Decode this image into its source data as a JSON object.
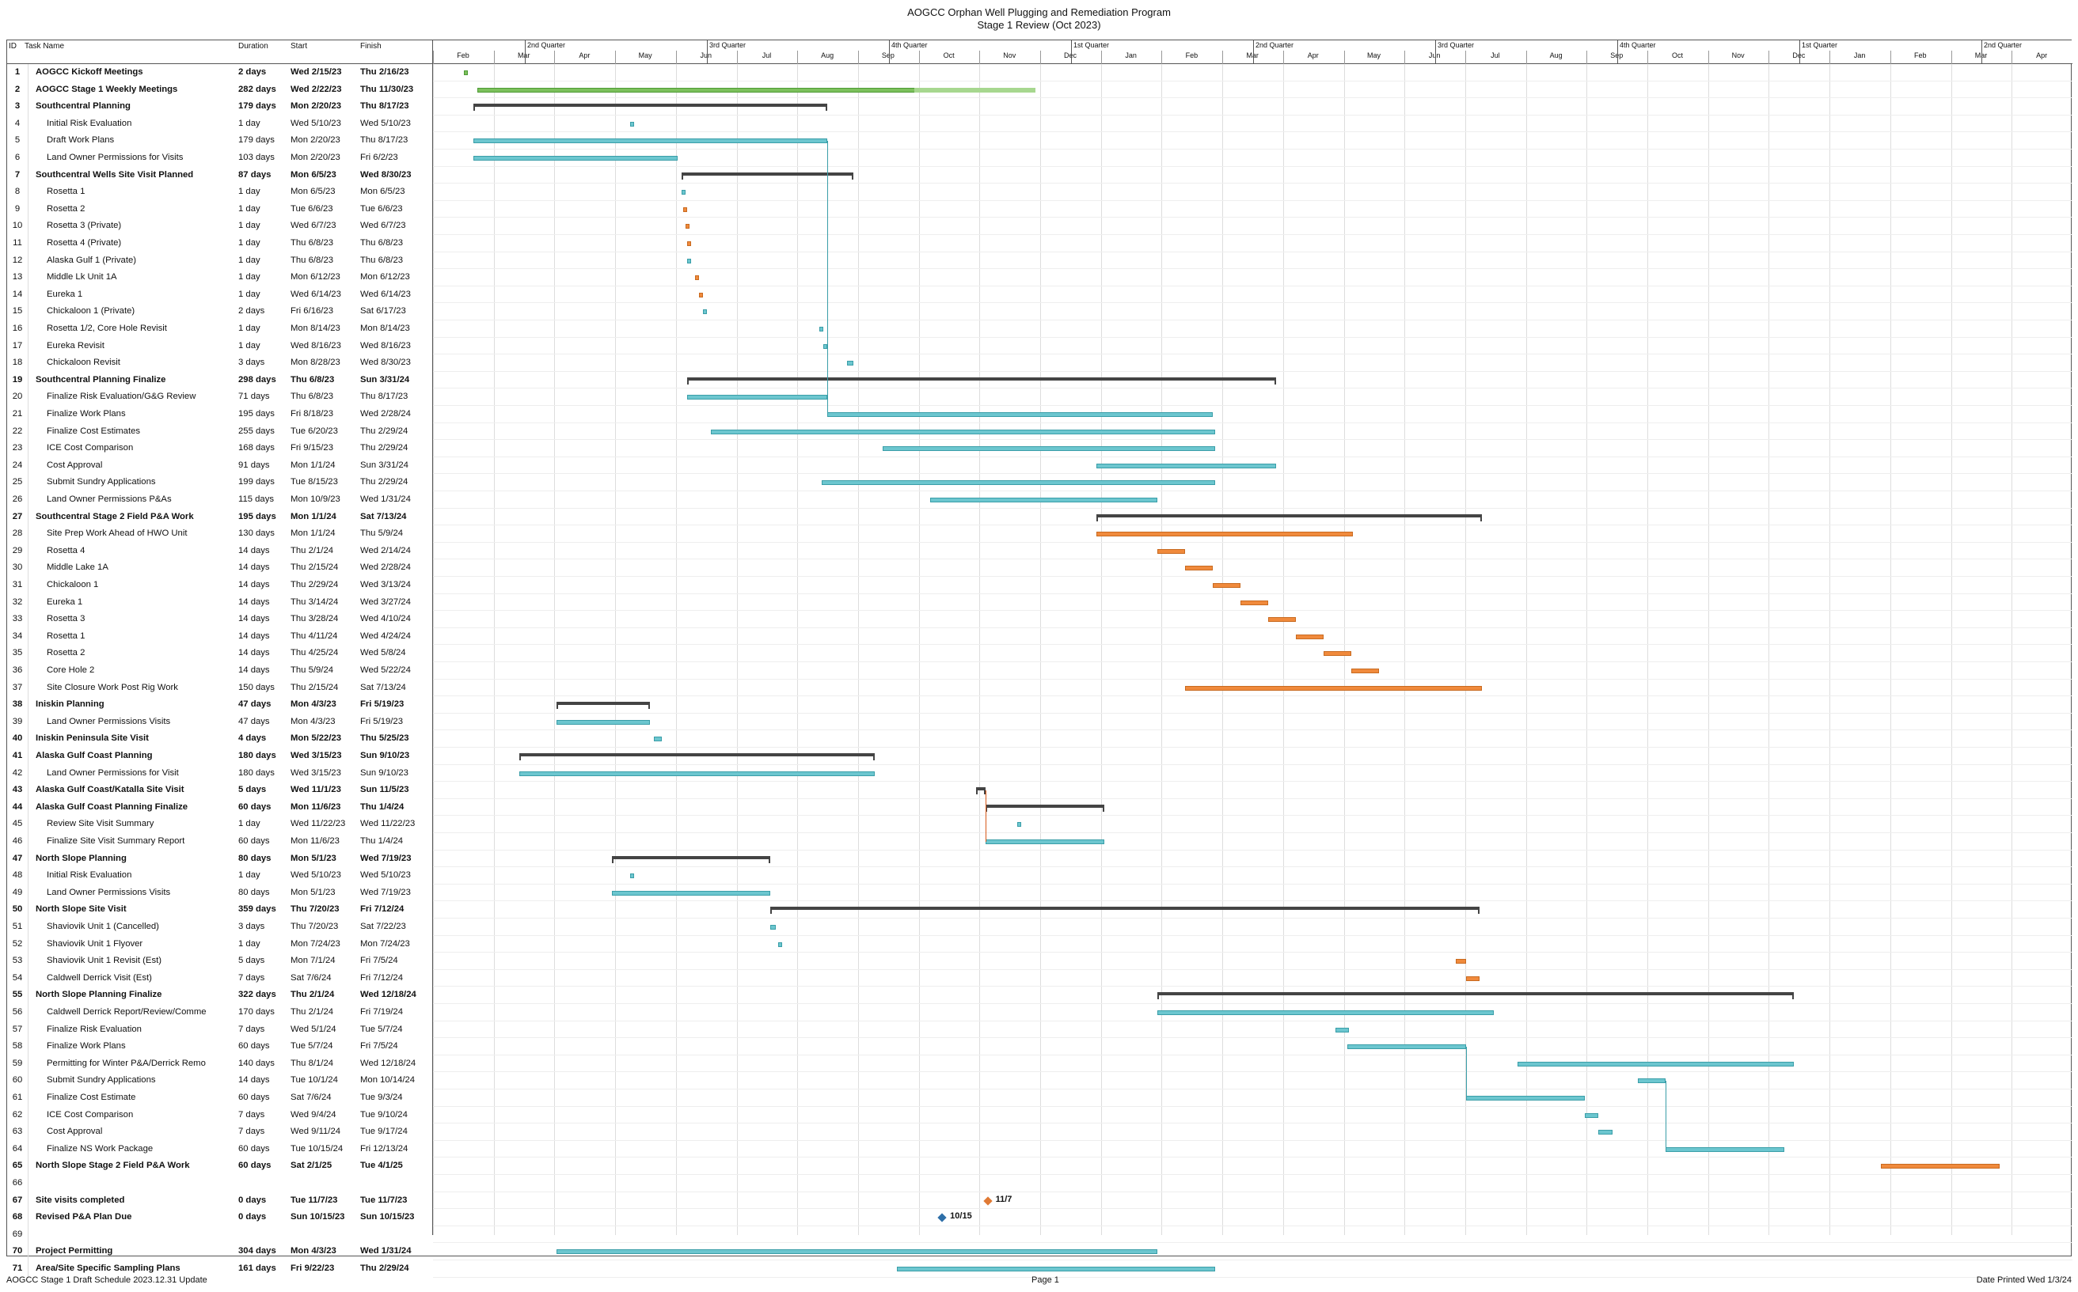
{
  "title": {
    "line1": "AOGCC Orphan Well Plugging and Remediation Program",
    "line2": "Stage 1 Review (Oct 2023)"
  },
  "columns": {
    "id": "ID",
    "name": "Task Name",
    "duration": "Duration",
    "start": "Start",
    "finish": "Finish"
  },
  "timeline": {
    "quarters": [
      "2nd Quarter",
      "3rd Quarter",
      "4th Quarter",
      "1st Quarter",
      "2nd Quarter",
      "3rd Quarter",
      "4th Quarter",
      "1st Quarter",
      "2nd Quarter"
    ],
    "months": [
      "Feb",
      "Mar",
      "Apr",
      "May",
      "Jun",
      "Jul",
      "Aug",
      "Sep",
      "Oct",
      "Nov",
      "Dec",
      "Jan",
      "Feb",
      "Mar",
      "Apr",
      "May",
      "Jun",
      "Jul",
      "Aug",
      "Sep",
      "Oct",
      "Nov",
      "Dec",
      "Jan",
      "Feb",
      "Mar",
      "Apr"
    ]
  },
  "rows": [
    {
      "id": "1",
      "name": "AOGCC Kickoff Meetings",
      "duration": "2 days",
      "start": "Wed 2/15/23",
      "finish": "Thu 2/16/23",
      "level": 0,
      "summary": true
    },
    {
      "id": "2",
      "name": "AOGCC Stage 1 Weekly Meetings",
      "duration": "282 days",
      "start": "Wed 2/22/23",
      "finish": "Thu 11/30/23",
      "level": 0,
      "summary": true
    },
    {
      "id": "3",
      "name": "Southcentral Planning",
      "duration": "179 days",
      "start": "Mon 2/20/23",
      "finish": "Thu 8/17/23",
      "level": 0,
      "summary": true
    },
    {
      "id": "4",
      "name": "Initial Risk Evaluation",
      "duration": "1 day",
      "start": "Wed 5/10/23",
      "finish": "Wed 5/10/23",
      "level": 1
    },
    {
      "id": "5",
      "name": "Draft Work Plans",
      "duration": "179 days",
      "start": "Mon 2/20/23",
      "finish": "Thu 8/17/23",
      "level": 1
    },
    {
      "id": "6",
      "name": "Land Owner Permissions for Visits",
      "duration": "103 days",
      "start": "Mon 2/20/23",
      "finish": "Fri 6/2/23",
      "level": 1
    },
    {
      "id": "7",
      "name": "Southcentral Wells Site Visit Planned",
      "duration": "87 days",
      "start": "Mon 6/5/23",
      "finish": "Wed 8/30/23",
      "level": 0,
      "summary": true
    },
    {
      "id": "8",
      "name": "Rosetta 1",
      "duration": "1 day",
      "start": "Mon 6/5/23",
      "finish": "Mon 6/5/23",
      "level": 1
    },
    {
      "id": "9",
      "name": "Rosetta 2",
      "duration": "1 day",
      "start": "Tue 6/6/23",
      "finish": "Tue 6/6/23",
      "level": 1
    },
    {
      "id": "10",
      "name": "Rosetta 3 (Private)",
      "duration": "1 day",
      "start": "Wed 6/7/23",
      "finish": "Wed 6/7/23",
      "level": 1
    },
    {
      "id": "11",
      "name": "Rosetta 4 (Private)",
      "duration": "1 day",
      "start": "Thu 6/8/23",
      "finish": "Thu 6/8/23",
      "level": 1
    },
    {
      "id": "12",
      "name": "Alaska Gulf 1 (Private)",
      "duration": "1 day",
      "start": "Thu 6/8/23",
      "finish": "Thu 6/8/23",
      "level": 1
    },
    {
      "id": "13",
      "name": "Middle Lk Unit 1A",
      "duration": "1 day",
      "start": "Mon 6/12/23",
      "finish": "Mon 6/12/23",
      "level": 1
    },
    {
      "id": "14",
      "name": "Eureka 1",
      "duration": "1 day",
      "start": "Wed 6/14/23",
      "finish": "Wed 6/14/23",
      "level": 1
    },
    {
      "id": "15",
      "name": "Chickaloon 1 (Private)",
      "duration": "2 days",
      "start": "Fri 6/16/23",
      "finish": "Sat 6/17/23",
      "level": 1
    },
    {
      "id": "16",
      "name": "Rosetta 1/2, Core Hole Revisit",
      "duration": "1 day",
      "start": "Mon 8/14/23",
      "finish": "Mon 8/14/23",
      "level": 1
    },
    {
      "id": "17",
      "name": "Eureka Revisit",
      "duration": "1 day",
      "start": "Wed 8/16/23",
      "finish": "Wed 8/16/23",
      "level": 1
    },
    {
      "id": "18",
      "name": "Chickaloon Revisit",
      "duration": "3 days",
      "start": "Mon 8/28/23",
      "finish": "Wed 8/30/23",
      "level": 1
    },
    {
      "id": "19",
      "name": "Southcentral Planning Finalize",
      "duration": "298 days",
      "start": "Thu 6/8/23",
      "finish": "Sun 3/31/24",
      "level": 0,
      "summary": true
    },
    {
      "id": "20",
      "name": "Finalize Risk Evaluation/G&G Review",
      "duration": "71 days",
      "start": "Thu 6/8/23",
      "finish": "Thu 8/17/23",
      "level": 1
    },
    {
      "id": "21",
      "name": "Finalize Work Plans",
      "duration": "195 days",
      "start": "Fri 8/18/23",
      "finish": "Wed 2/28/24",
      "level": 1
    },
    {
      "id": "22",
      "name": "Finalize Cost Estimates",
      "duration": "255 days",
      "start": "Tue 6/20/23",
      "finish": "Thu 2/29/24",
      "level": 1
    },
    {
      "id": "23",
      "name": "ICE Cost Comparison",
      "duration": "168 days",
      "start": "Fri 9/15/23",
      "finish": "Thu 2/29/24",
      "level": 1
    },
    {
      "id": "24",
      "name": "Cost Approval",
      "duration": "91 days",
      "start": "Mon 1/1/24",
      "finish": "Sun 3/31/24",
      "level": 1
    },
    {
      "id": "25",
      "name": "Submit Sundry Applications",
      "duration": "199 days",
      "start": "Tue 8/15/23",
      "finish": "Thu 2/29/24",
      "level": 1
    },
    {
      "id": "26",
      "name": "Land Owner Permissions P&As",
      "duration": "115 days",
      "start": "Mon 10/9/23",
      "finish": "Wed 1/31/24",
      "level": 1
    },
    {
      "id": "27",
      "name": "Southcentral Stage 2 Field P&A Work",
      "duration": "195 days",
      "start": "Mon 1/1/24",
      "finish": "Sat 7/13/24",
      "level": 0,
      "summary": true
    },
    {
      "id": "28",
      "name": "Site Prep Work Ahead of HWO Unit",
      "duration": "130 days",
      "start": "Mon 1/1/24",
      "finish": "Thu 5/9/24",
      "level": 1
    },
    {
      "id": "29",
      "name": "Rosetta 4",
      "duration": "14 days",
      "start": "Thu 2/1/24",
      "finish": "Wed 2/14/24",
      "level": 1
    },
    {
      "id": "30",
      "name": "Middle Lake 1A",
      "duration": "14 days",
      "start": "Thu 2/15/24",
      "finish": "Wed 2/28/24",
      "level": 1
    },
    {
      "id": "31",
      "name": "Chickaloon 1",
      "duration": "14 days",
      "start": "Thu 2/29/24",
      "finish": "Wed 3/13/24",
      "level": 1
    },
    {
      "id": "32",
      "name": "Eureka 1",
      "duration": "14 days",
      "start": "Thu 3/14/24",
      "finish": "Wed 3/27/24",
      "level": 1
    },
    {
      "id": "33",
      "name": "Rosetta 3",
      "duration": "14 days",
      "start": "Thu 3/28/24",
      "finish": "Wed 4/10/24",
      "level": 1
    },
    {
      "id": "34",
      "name": "Rosetta 1",
      "duration": "14 days",
      "start": "Thu 4/11/24",
      "finish": "Wed 4/24/24",
      "level": 1
    },
    {
      "id": "35",
      "name": "Rosetta 2",
      "duration": "14 days",
      "start": "Thu 4/25/24",
      "finish": "Wed 5/8/24",
      "level": 1
    },
    {
      "id": "36",
      "name": "Core Hole 2",
      "duration": "14 days",
      "start": "Thu 5/9/24",
      "finish": "Wed 5/22/24",
      "level": 1
    },
    {
      "id": "37",
      "name": "Site Closure Work Post Rig Work",
      "duration": "150 days",
      "start": "Thu 2/15/24",
      "finish": "Sat 7/13/24",
      "level": 1
    },
    {
      "id": "38",
      "name": "Iniskin Planning",
      "duration": "47 days",
      "start": "Mon 4/3/23",
      "finish": "Fri 5/19/23",
      "level": 0,
      "summary": true
    },
    {
      "id": "39",
      "name": "Land Owner Permissions Visits",
      "duration": "47 days",
      "start": "Mon 4/3/23",
      "finish": "Fri 5/19/23",
      "level": 1
    },
    {
      "id": "40",
      "name": "Iniskin Peninsula Site Visit",
      "duration": "4 days",
      "start": "Mon 5/22/23",
      "finish": "Thu 5/25/23",
      "level": 0,
      "summary": true
    },
    {
      "id": "41",
      "name": "Alaska Gulf Coast Planning",
      "duration": "180 days",
      "start": "Wed 3/15/23",
      "finish": "Sun 9/10/23",
      "level": 0,
      "summary": true
    },
    {
      "id": "42",
      "name": "Land Owner Permissions for Visit",
      "duration": "180 days",
      "start": "Wed 3/15/23",
      "finish": "Sun 9/10/23",
      "level": 1
    },
    {
      "id": "43",
      "name": "Alaska Gulf Coast/Katalla Site Visit",
      "duration": "5 days",
      "start": "Wed 11/1/23",
      "finish": "Sun 11/5/23",
      "level": 0,
      "summary": true
    },
    {
      "id": "44",
      "name": "Alaska Gulf Coast Planning Finalize",
      "duration": "60 days",
      "start": "Mon 11/6/23",
      "finish": "Thu 1/4/24",
      "level": 0,
      "summary": true
    },
    {
      "id": "45",
      "name": "Review Site Visit Summary",
      "duration": "1 day",
      "start": "Wed 11/22/23",
      "finish": "Wed 11/22/23",
      "level": 1
    },
    {
      "id": "46",
      "name": "Finalize Site Visit Summary Report",
      "duration": "60 days",
      "start": "Mon 11/6/23",
      "finish": "Thu 1/4/24",
      "level": 1
    },
    {
      "id": "47",
      "name": "North Slope Planning",
      "duration": "80 days",
      "start": "Mon 5/1/23",
      "finish": "Wed 7/19/23",
      "level": 0,
      "summary": true
    },
    {
      "id": "48",
      "name": "Initial Risk Evaluation",
      "duration": "1 day",
      "start": "Wed 5/10/23",
      "finish": "Wed 5/10/23",
      "level": 1
    },
    {
      "id": "49",
      "name": "Land Owner Permissions Visits",
      "duration": "80 days",
      "start": "Mon 5/1/23",
      "finish": "Wed 7/19/23",
      "level": 1
    },
    {
      "id": "50",
      "name": "North Slope Site Visit",
      "duration": "359 days",
      "start": "Thu 7/20/23",
      "finish": "Fri 7/12/24",
      "level": 0,
      "summary": true
    },
    {
      "id": "51",
      "name": "Shaviovik Unit 1 (Cancelled)",
      "duration": "3 days",
      "start": "Thu 7/20/23",
      "finish": "Sat 7/22/23",
      "level": 1
    },
    {
      "id": "52",
      "name": "Shaviovik Unit 1 Flyover",
      "duration": "1 day",
      "start": "Mon 7/24/23",
      "finish": "Mon 7/24/23",
      "level": 1
    },
    {
      "id": "53",
      "name": "Shaviovik Unit 1 Revisit (Est)",
      "duration": "5 days",
      "start": "Mon 7/1/24",
      "finish": "Fri 7/5/24",
      "level": 1
    },
    {
      "id": "54",
      "name": "Caldwell Derrick Visit (Est)",
      "duration": "7 days",
      "start": "Sat 7/6/24",
      "finish": "Fri 7/12/24",
      "level": 1
    },
    {
      "id": "55",
      "name": "North Slope Planning Finalize",
      "duration": "322 days",
      "start": "Thu 2/1/24",
      "finish": "Wed 12/18/24",
      "level": 0,
      "summary": true
    },
    {
      "id": "56",
      "name": "Caldwell Derrick Report/Review/Comme",
      "duration": "170 days",
      "start": "Thu 2/1/24",
      "finish": "Fri 7/19/24",
      "level": 1
    },
    {
      "id": "57",
      "name": "Finalize Risk Evaluation",
      "duration": "7 days",
      "start": "Wed 5/1/24",
      "finish": "Tue 5/7/24",
      "level": 1
    },
    {
      "id": "58",
      "name": "Finalize Work Plans",
      "duration": "60 days",
      "start": "Tue 5/7/24",
      "finish": "Fri 7/5/24",
      "level": 1
    },
    {
      "id": "59",
      "name": "Permitting for Winter P&A/Derrick Remo",
      "duration": "140 days",
      "start": "Thu 8/1/24",
      "finish": "Wed 12/18/24",
      "level": 1
    },
    {
      "id": "60",
      "name": "Submit Sundry Applications",
      "duration": "14 days",
      "start": "Tue 10/1/24",
      "finish": "Mon 10/14/24",
      "level": 1
    },
    {
      "id": "61",
      "name": "Finalize Cost Estimate",
      "duration": "60 days",
      "start": "Sat 7/6/24",
      "finish": "Tue 9/3/24",
      "level": 1
    },
    {
      "id": "62",
      "name": "ICE Cost Comparison",
      "duration": "7 days",
      "start": "Wed 9/4/24",
      "finish": "Tue 9/10/24",
      "level": 1
    },
    {
      "id": "63",
      "name": "Cost Approval",
      "duration": "7 days",
      "start": "Wed 9/11/24",
      "finish": "Tue 9/17/24",
      "level": 1
    },
    {
      "id": "64",
      "name": "Finalize NS Work Package",
      "duration": "60 days",
      "start": "Tue 10/15/24",
      "finish": "Fri 12/13/24",
      "level": 1
    },
    {
      "id": "65",
      "name": "North Slope Stage 2 Field P&A Work",
      "duration": "60 days",
      "start": "Sat 2/1/25",
      "finish": "Tue 4/1/25",
      "level": 0,
      "summary": true
    },
    {
      "id": "66",
      "name": "",
      "duration": "",
      "start": "",
      "finish": "",
      "level": 0
    },
    {
      "id": "67",
      "name": "Site visits completed",
      "duration": "0 days",
      "start": "Tue 11/7/23",
      "finish": "Tue 11/7/23",
      "level": 0,
      "summary": true
    },
    {
      "id": "68",
      "name": "Revised P&A Plan Due",
      "duration": "0 days",
      "start": "Sun 10/15/23",
      "finish": "Sun 10/15/23",
      "level": 0,
      "summary": true
    },
    {
      "id": "69",
      "name": "",
      "duration": "",
      "start": "",
      "finish": "",
      "level": 0
    },
    {
      "id": "70",
      "name": "Project Permitting",
      "duration": "304 days",
      "start": "Mon 4/3/23",
      "finish": "Wed 1/31/24",
      "level": 0,
      "summary": true
    },
    {
      "id": "71",
      "name": "Area/Site Specific Sampling Plans",
      "duration": "161 days",
      "start": "Fri 9/22/23",
      "finish": "Thu 2/29/24",
      "level": 0,
      "summary": true
    }
  ],
  "milestones": [
    {
      "row": "67",
      "label": "11/7",
      "color": "#e07a35"
    },
    {
      "row": "68",
      "label": "10/15",
      "color": "#2e6fa8"
    }
  ],
  "colors": {
    "task": "#6cc6cf",
    "critical": "#f08a3c",
    "complete": "#7cc05c",
    "summary": "#444444"
  },
  "footer": {
    "left": "AOGCC Stage 1 Draft Schedule 2023.12.31 Update",
    "center": "Page 1",
    "right": "Date Printed Wed 1/3/24"
  }
}
